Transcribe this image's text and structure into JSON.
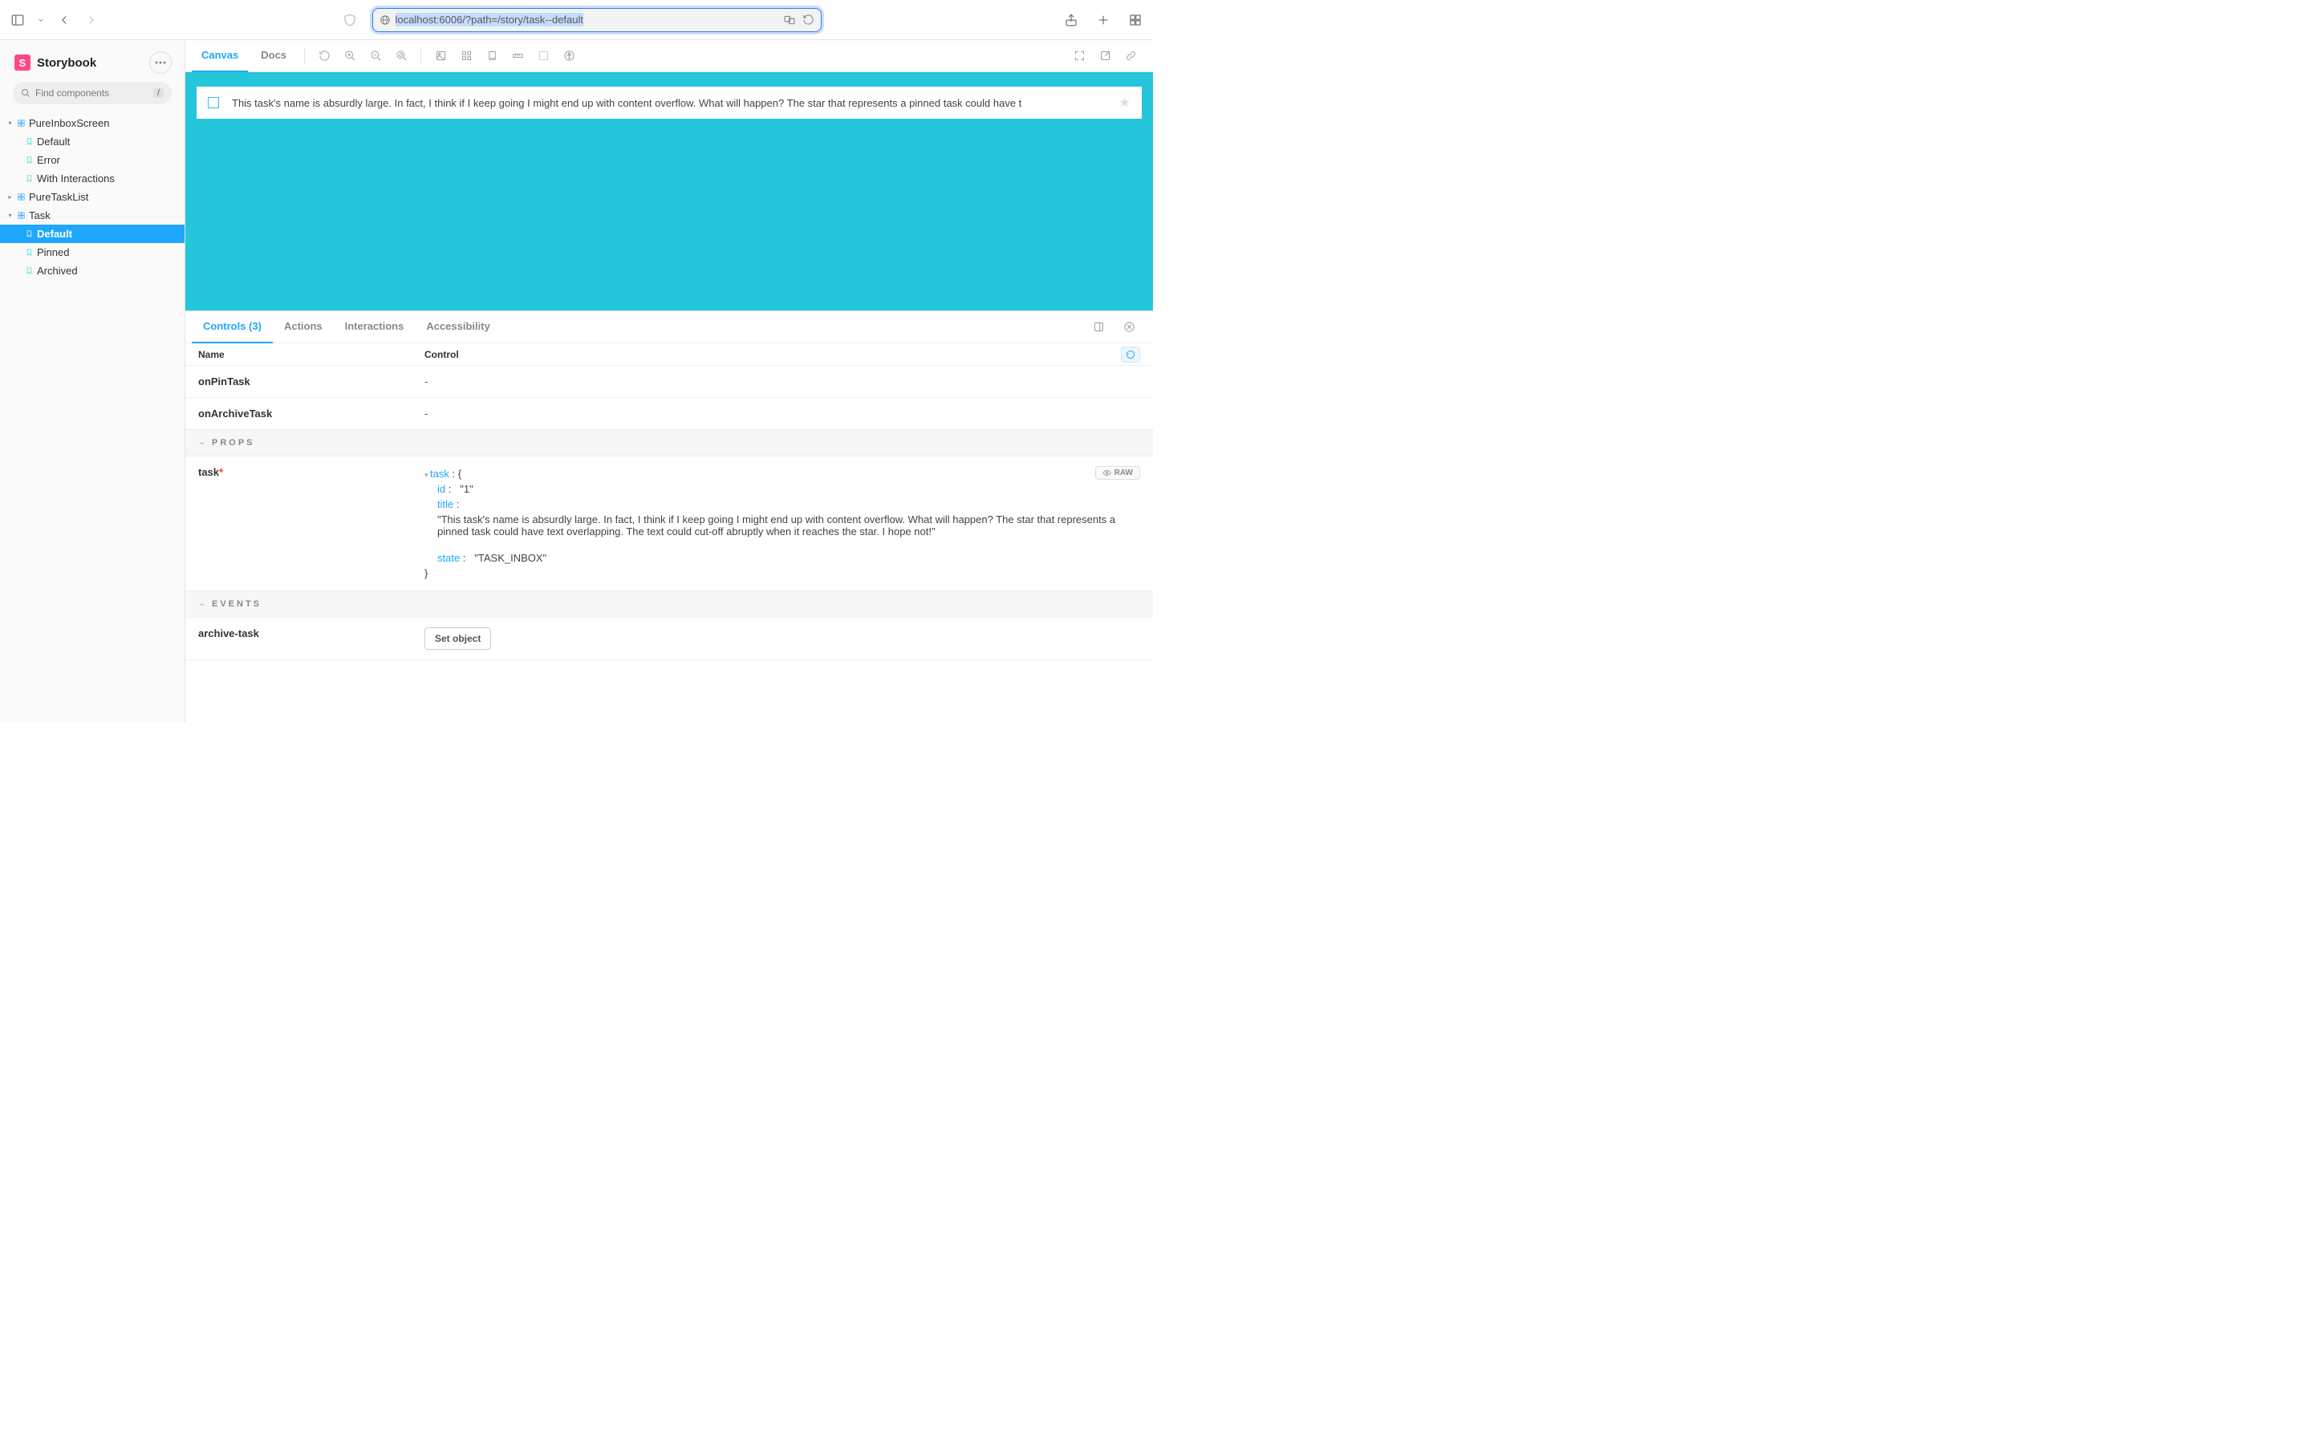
{
  "browser": {
    "url": "localhost:6006/?path=/story/task--default"
  },
  "brand": {
    "name": "Storybook",
    "logo_letter": "S"
  },
  "search": {
    "placeholder": "Find components",
    "shortcut": "/"
  },
  "tree": [
    {
      "type": "component",
      "label": "PureInboxScreen",
      "expanded": true,
      "children": [
        {
          "type": "story",
          "label": "Default"
        },
        {
          "type": "story",
          "label": "Error"
        },
        {
          "type": "story",
          "label": "With Interactions"
        }
      ]
    },
    {
      "type": "component",
      "label": "PureTaskList",
      "expanded": false,
      "children": []
    },
    {
      "type": "component",
      "label": "Task",
      "expanded": true,
      "children": [
        {
          "type": "story",
          "label": "Default",
          "active": true
        },
        {
          "type": "story",
          "label": "Pinned"
        },
        {
          "type": "story",
          "label": "Archived"
        }
      ]
    }
  ],
  "toolbar_tabs": {
    "canvas": "Canvas",
    "docs": "Docs"
  },
  "preview": {
    "task_text": "This task's name is absurdly large. In fact, I think if I keep going I might end up with content overflow. What will happen? The star that represents a pinned task could have t"
  },
  "addons": {
    "tabs": {
      "controls": "Controls (3)",
      "actions": "Actions",
      "interactions": "Interactions",
      "accessibility": "Accessibility"
    },
    "head": {
      "name": "Name",
      "control": "Control"
    },
    "rows_top": [
      {
        "name": "onPinTask",
        "control": "-"
      },
      {
        "name": "onArchiveTask",
        "control": "-"
      }
    ],
    "section_props": "PROPS",
    "task_row_name": "task",
    "task_object": {
      "label": "task",
      "open": "{",
      "close": "}",
      "fields": [
        {
          "key": "id",
          "value": "\"1\""
        },
        {
          "key": "title",
          "value": ""
        },
        {
          "key_only": false,
          "full_text": "\"This task's name is absurdly large. In fact, I think if I keep going I might end up with content overflow. What will happen? The star that represents a pinned task could have text overlapping. The text could cut-off abruptly when it reaches the star. I hope not!\""
        },
        {
          "key": "state",
          "value": "\"TASK_INBOX\""
        }
      ]
    },
    "raw_label": "RAW",
    "section_events": "EVENTS",
    "events_row": {
      "name": "archive-task",
      "button": "Set object"
    }
  }
}
